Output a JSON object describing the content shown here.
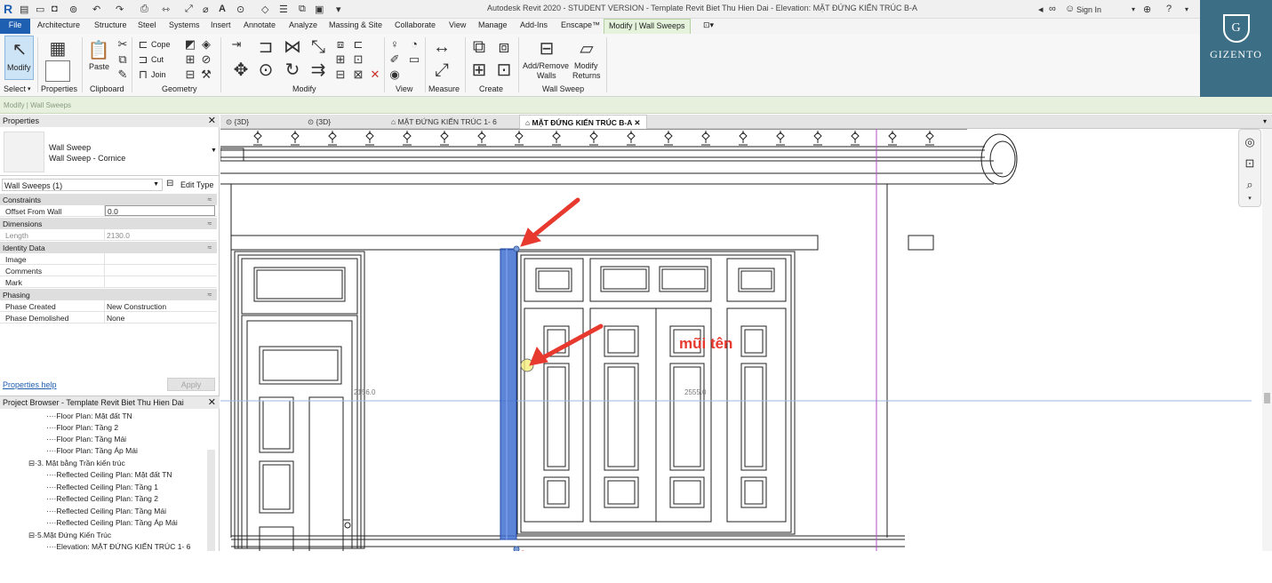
{
  "window": {
    "title": "Autodesk Revit 2020 - STUDENT VERSION - Template Revit Biet Thu Hien Dai - Elevation: MẶT ĐỨNG KIẾN TRÚC B-A",
    "sign_in": "Sign In"
  },
  "ribbon_tabs": [
    "File",
    "Architecture",
    "Structure",
    "Steel",
    "Systems",
    "Insert",
    "Annotate",
    "Analyze",
    "Massing & Site",
    "Collaborate",
    "View",
    "Manage",
    "Add-Ins",
    "Enscape™",
    "Modify | Wall Sweeps"
  ],
  "ribbon": {
    "modify_label": "Modify",
    "select_label": "Select",
    "properties_label": "Properties",
    "paste_label": "Paste",
    "cope_label": "Cope",
    "cut_label": "Cut",
    "join_label": "Join",
    "panels": {
      "clipboard": "Clipboard",
      "geometry": "Geometry",
      "modify": "Modify",
      "view": "View",
      "measure": "Measure",
      "create": "Create",
      "wall_sweep": "Wall Sweep"
    },
    "add_remove_walls": [
      "Add/Remove",
      "Walls"
    ],
    "modify_returns": [
      "Modify",
      "Returns"
    ]
  },
  "brand": {
    "letter": "G",
    "name": "GIZENTO"
  },
  "options_bar": "Modify | Wall Sweeps",
  "properties": {
    "title": "Properties",
    "family": "Wall Sweep",
    "type": "Wall Sweep - Cornice",
    "selector": "Wall Sweeps (1)",
    "edit_type": "Edit Type",
    "groups": [
      {
        "name": "Constraints",
        "rows": [
          {
            "k": "Offset From Wall",
            "v": "0.0"
          }
        ]
      },
      {
        "name": "Dimensions",
        "rows": [
          {
            "k": "Length",
            "v": "2130.0"
          }
        ]
      },
      {
        "name": "Identity Data",
        "rows": [
          {
            "k": "Image",
            "v": ""
          },
          {
            "k": "Comments",
            "v": ""
          },
          {
            "k": "Mark",
            "v": ""
          }
        ]
      },
      {
        "name": "Phasing",
        "rows": [
          {
            "k": "Phase Created",
            "v": "New Construction"
          },
          {
            "k": "Phase Demolished",
            "v": "None"
          }
        ]
      }
    ],
    "help": "Properties help",
    "apply": "Apply"
  },
  "browser": {
    "title": "Project Browser - Template Revit Biet Thu Hien Dai",
    "items": [
      "Floor Plan: Mặt đất TN",
      "Floor Plan: Tầng 2",
      "Floor Plan: Tầng Mái",
      "Floor Plan: Tầng Áp Mái",
      "3. Mặt bằng Trần kiến trúc",
      "Reflected Ceiling Plan: Mặt đất TN",
      "Reflected Ceiling Plan: Tầng 1",
      "Reflected Ceiling Plan: Tầng 2",
      "Reflected Ceiling Plan: Tầng Mái",
      "Reflected Ceiling Plan: Tầng Áp Mái",
      "5.Mặt Đứng Kiến Trúc",
      "Elevation: MẶT ĐỨNG KIẾN TRÚC 1- 6"
    ]
  },
  "view_tabs": [
    "{3D}",
    "{3D}",
    "MẶT ĐỨNG KIẾN TRÚC 1- 6",
    "MẶT ĐỨNG KIẾN TRÚC B-A"
  ],
  "canvas": {
    "dim_left": "2156.0",
    "dim_right": "2555.0",
    "annotation": "mũi tên"
  },
  "colors": {
    "revit_blue": "#1f5fb2",
    "selection_blue": "#3f6fd0",
    "arrow_red": "#e8392f",
    "modify_tab_green": "#e6f3dc",
    "brand_teal": "#3c6f86"
  }
}
